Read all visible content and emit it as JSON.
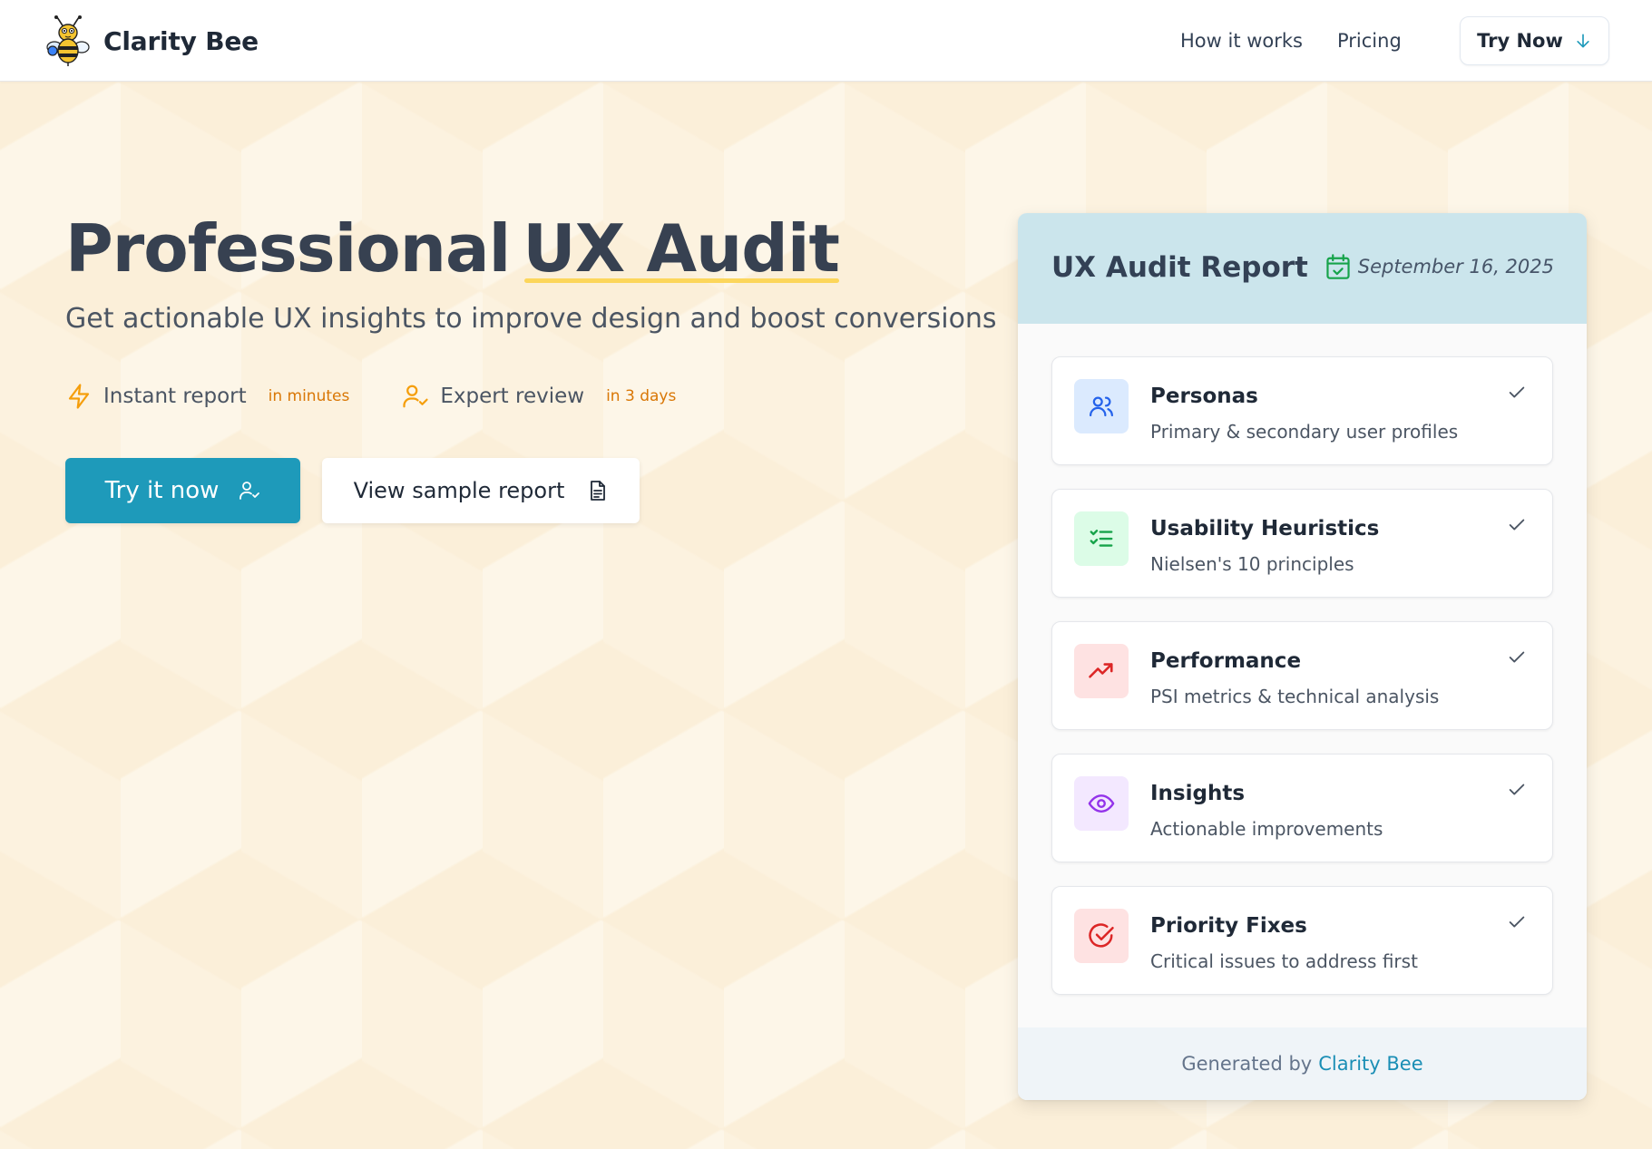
{
  "header": {
    "brand": "Clarity Bee",
    "nav": [
      "How it works",
      "Pricing"
    ],
    "cta_label": "Try Now"
  },
  "hero": {
    "title_part1": "Professional",
    "title_part2": "UX Audit",
    "subtitle": "Get actionable UX insights to improve design and boost conversions",
    "features": [
      {
        "label": "Instant report",
        "badge": "in minutes",
        "icon": "lightning-icon"
      },
      {
        "label": "Expert review",
        "badge": "in 3 days",
        "icon": "user-check-icon"
      }
    ],
    "primary_button": "Try it now",
    "secondary_button": "View sample report"
  },
  "report": {
    "title": "UX Audit Report",
    "date": "September 16, 2025",
    "items": [
      {
        "title": "Personas",
        "desc": "Primary & secondary user profiles",
        "icon": "users-icon",
        "bg": "#dbeafe",
        "fg": "#2563eb"
      },
      {
        "title": "Usability Heuristics",
        "desc": "Nielsen's 10 principles",
        "icon": "checklist-icon",
        "bg": "#dcfce7",
        "fg": "#16a34a"
      },
      {
        "title": "Performance",
        "desc": "PSI metrics & technical analysis",
        "icon": "trending-up-icon",
        "bg": "#fee2e2",
        "fg": "#dc2626"
      },
      {
        "title": "Insights",
        "desc": "Actionable improvements",
        "icon": "eye-icon",
        "bg": "#f3e8ff",
        "fg": "#9333ea"
      },
      {
        "title": "Priority Fixes",
        "desc": "Critical issues to address first",
        "icon": "target-check-icon",
        "bg": "#fee2e2",
        "fg": "#dc2626"
      }
    ],
    "footer_prefix": "Generated by",
    "footer_brand": "Clarity Bee"
  },
  "colors": {
    "primary": "#1e9aba",
    "accent": "#d97706",
    "highlight": "#fcd34d"
  }
}
